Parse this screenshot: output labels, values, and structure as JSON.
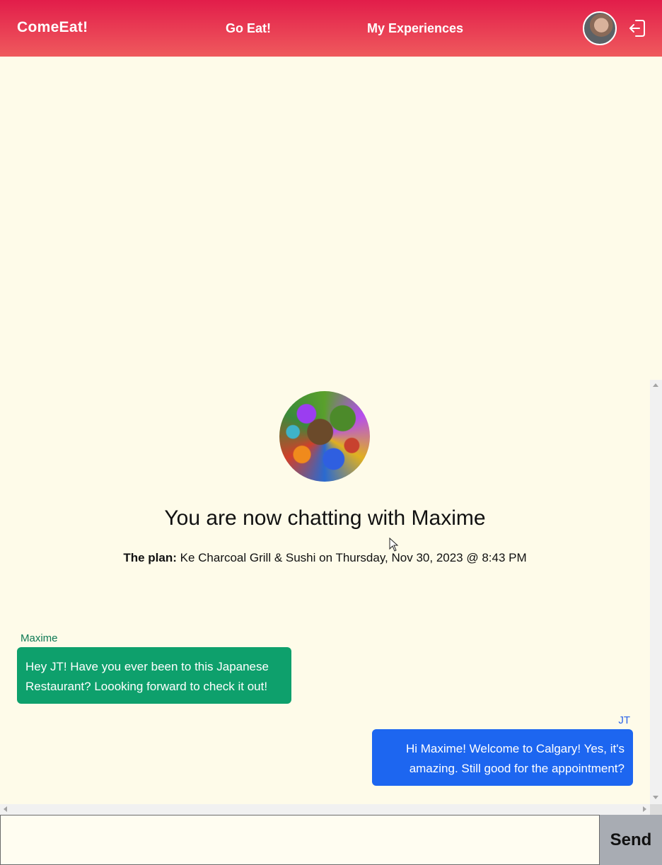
{
  "header": {
    "brand": "ComeEat!",
    "nav": [
      {
        "label": "Go Eat!"
      },
      {
        "label": "My Experiences"
      }
    ],
    "avatar_icon": "user-avatar",
    "logout_icon": "logout-icon"
  },
  "chat": {
    "partner_avatar_icon": "partner-avatar",
    "title": "You are now chatting with Maxime",
    "plan_label": "The plan:",
    "plan_text": " Ke Charcoal Grill & Sushi on Thursday, Nov 30, 2023 @ 8:43 PM",
    "messages": [
      {
        "sender": "Maxime",
        "text": "Hey JT! Have you ever been to this Japanese Restaurant? Loooking forward to check it out!",
        "color": "#0ea06c"
      },
      {
        "sender": "JT",
        "text": "Hi Maxime! Welcome to Calgary! Yes, it's amazing. Still good for the appointment?",
        "color": "#1d66f0"
      }
    ]
  },
  "composer": {
    "input_value": "",
    "send_label": "Send"
  },
  "colors": {
    "header_top": "#e21d4a",
    "header_bottom": "#ef5a5d",
    "page_background": "#fefbe9",
    "send_button": "#a8acb3"
  }
}
